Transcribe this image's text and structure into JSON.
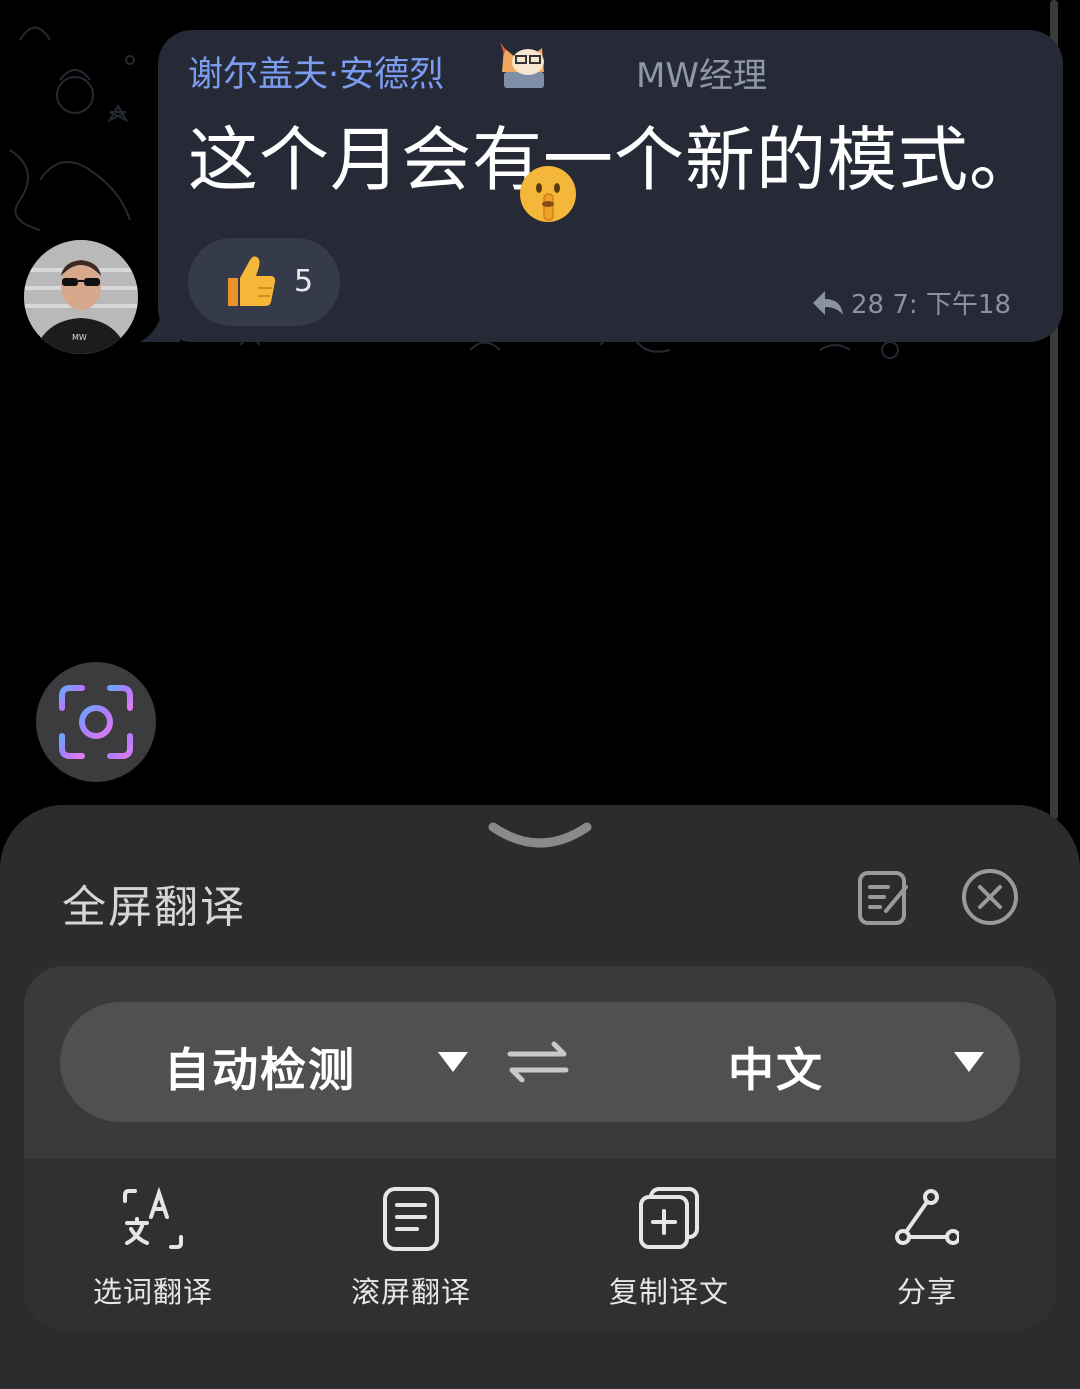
{
  "chat": {
    "sender": "谢尔盖夫·安德烈",
    "role": "MW经理",
    "message": "这个月会有一个新的模式。",
    "reaction_count": "5",
    "reply_meta": "28 7:  下午18"
  },
  "panel": {
    "title": "全屏翻译",
    "source_lang": "自动检测",
    "target_lang": "中文",
    "actions": [
      {
        "label": "选词翻译",
        "icon": "word-translate-icon"
      },
      {
        "label": "滚屏翻译",
        "icon": "scroll-translate-icon"
      },
      {
        "label": "复制译文",
        "icon": "copy-translation-icon"
      },
      {
        "label": "分享",
        "icon": "share-icon"
      }
    ]
  },
  "colors": {
    "sender_blue": "#7c9cf0",
    "bubble_bg": "#252a36",
    "panel_bg": "#2c2c2e",
    "card_bg": "#3a3a3c",
    "pill_bg": "#505052"
  }
}
